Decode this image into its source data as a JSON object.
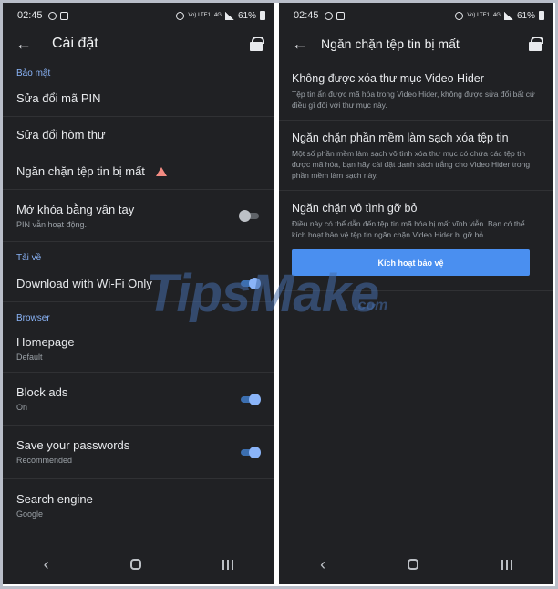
{
  "status": {
    "time": "02:45",
    "network": "Vo) LTE1",
    "net_4g": "4G",
    "battery": "61%"
  },
  "left": {
    "title": "Cài đặt",
    "sections": {
      "security": "Bảo mật",
      "download": "Tải về",
      "browser": "Browser"
    },
    "items": {
      "pin": {
        "label": "Sửa đổi mã PIN"
      },
      "mailbox": {
        "label": "Sửa đổi hòm thư"
      },
      "prevent_loss": {
        "label": "Ngăn chặn tệp tin bị mất"
      },
      "fingerprint": {
        "label": "Mở khóa bằng vân tay",
        "sub": "PIN vẫn hoạt động.",
        "toggle": "off"
      },
      "wifi_only": {
        "label": "Download with Wi-Fi Only",
        "toggle": "on"
      },
      "homepage": {
        "label": "Homepage",
        "sub": "Default"
      },
      "block_ads": {
        "label": "Block ads",
        "sub": "On",
        "toggle": "on"
      },
      "save_passwords": {
        "label": "Save your passwords",
        "sub": "Recommended",
        "toggle": "on"
      },
      "search_engine": {
        "label": "Search engine",
        "sub": "Google"
      }
    }
  },
  "right": {
    "title": "Ngăn chặn tệp tin bị mất",
    "blocks": [
      {
        "heading": "Không được xóa thư mục Video Hider",
        "desc": "Tệp tin ẩn được mã hóa trong Video Hider, không được sửa đổi bất cứ điều gì đối với thư mục này."
      },
      {
        "heading": "Ngăn chặn phần mềm làm sạch xóa tệp tin",
        "desc": "Một số phần mềm làm sạch vô tình xóa thư mục có chứa các tệp tin được mã hóa, bạn hãy cài đặt danh sách trắng cho Video Hider trong phần mềm làm sạch này."
      },
      {
        "heading": "Ngăn chặn vô tình gỡ bỏ",
        "desc": "Điều này có thể dẫn đến tệp tin mã hóa bị mất vĩnh viễn. Bạn có thể kích hoạt bảo vệ tệp tin ngăn chặn Video Hider bị gỡ bỏ."
      }
    ],
    "button": "Kích hoạt bảo vệ"
  },
  "watermark": {
    "main": "TipsMake",
    "suffix": ".com"
  },
  "colors": {
    "accent": "#8ab4f8",
    "button": "#4a8ff0",
    "background": "#202124",
    "warning": "#f28b82"
  }
}
